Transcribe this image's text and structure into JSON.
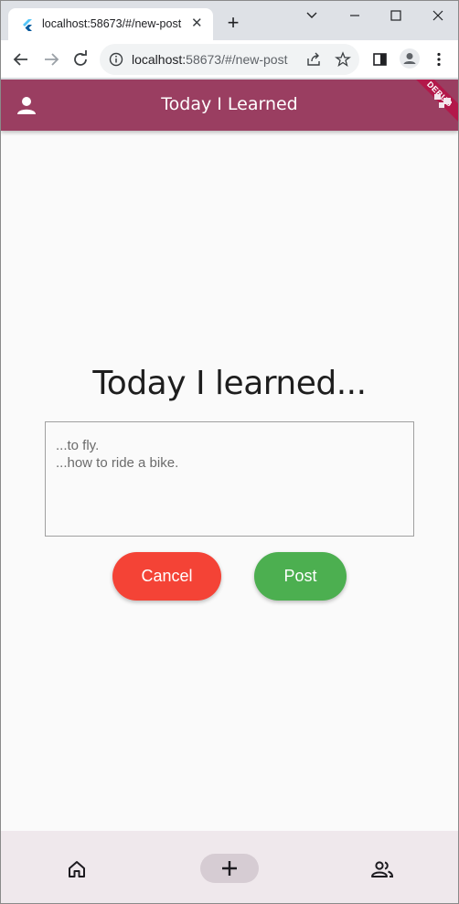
{
  "browser": {
    "tab_title": "localhost:58673/#/new-post",
    "tab_close": "✕",
    "new_tab": "+",
    "url_host": "localhost:",
    "url_path": "58673/#/new-post"
  },
  "app": {
    "title": "Today I Learned",
    "debug_banner": "DEBUG",
    "heading": "Today I learned...",
    "textbox": {
      "placeholder": "...to fly.\n...how to ride a bike.",
      "value": ""
    },
    "cancel_label": "Cancel",
    "post_label": "Post",
    "bottom_nav": {
      "items": [
        {
          "icon": "home-icon"
        },
        {
          "icon": "add-icon",
          "selected": true
        },
        {
          "icon": "people-icon"
        }
      ]
    }
  },
  "colors": {
    "appbar": "#9a3e61",
    "cancel": "#f44336",
    "post": "#4caf50",
    "bottom_nav": "#efe8ec"
  }
}
